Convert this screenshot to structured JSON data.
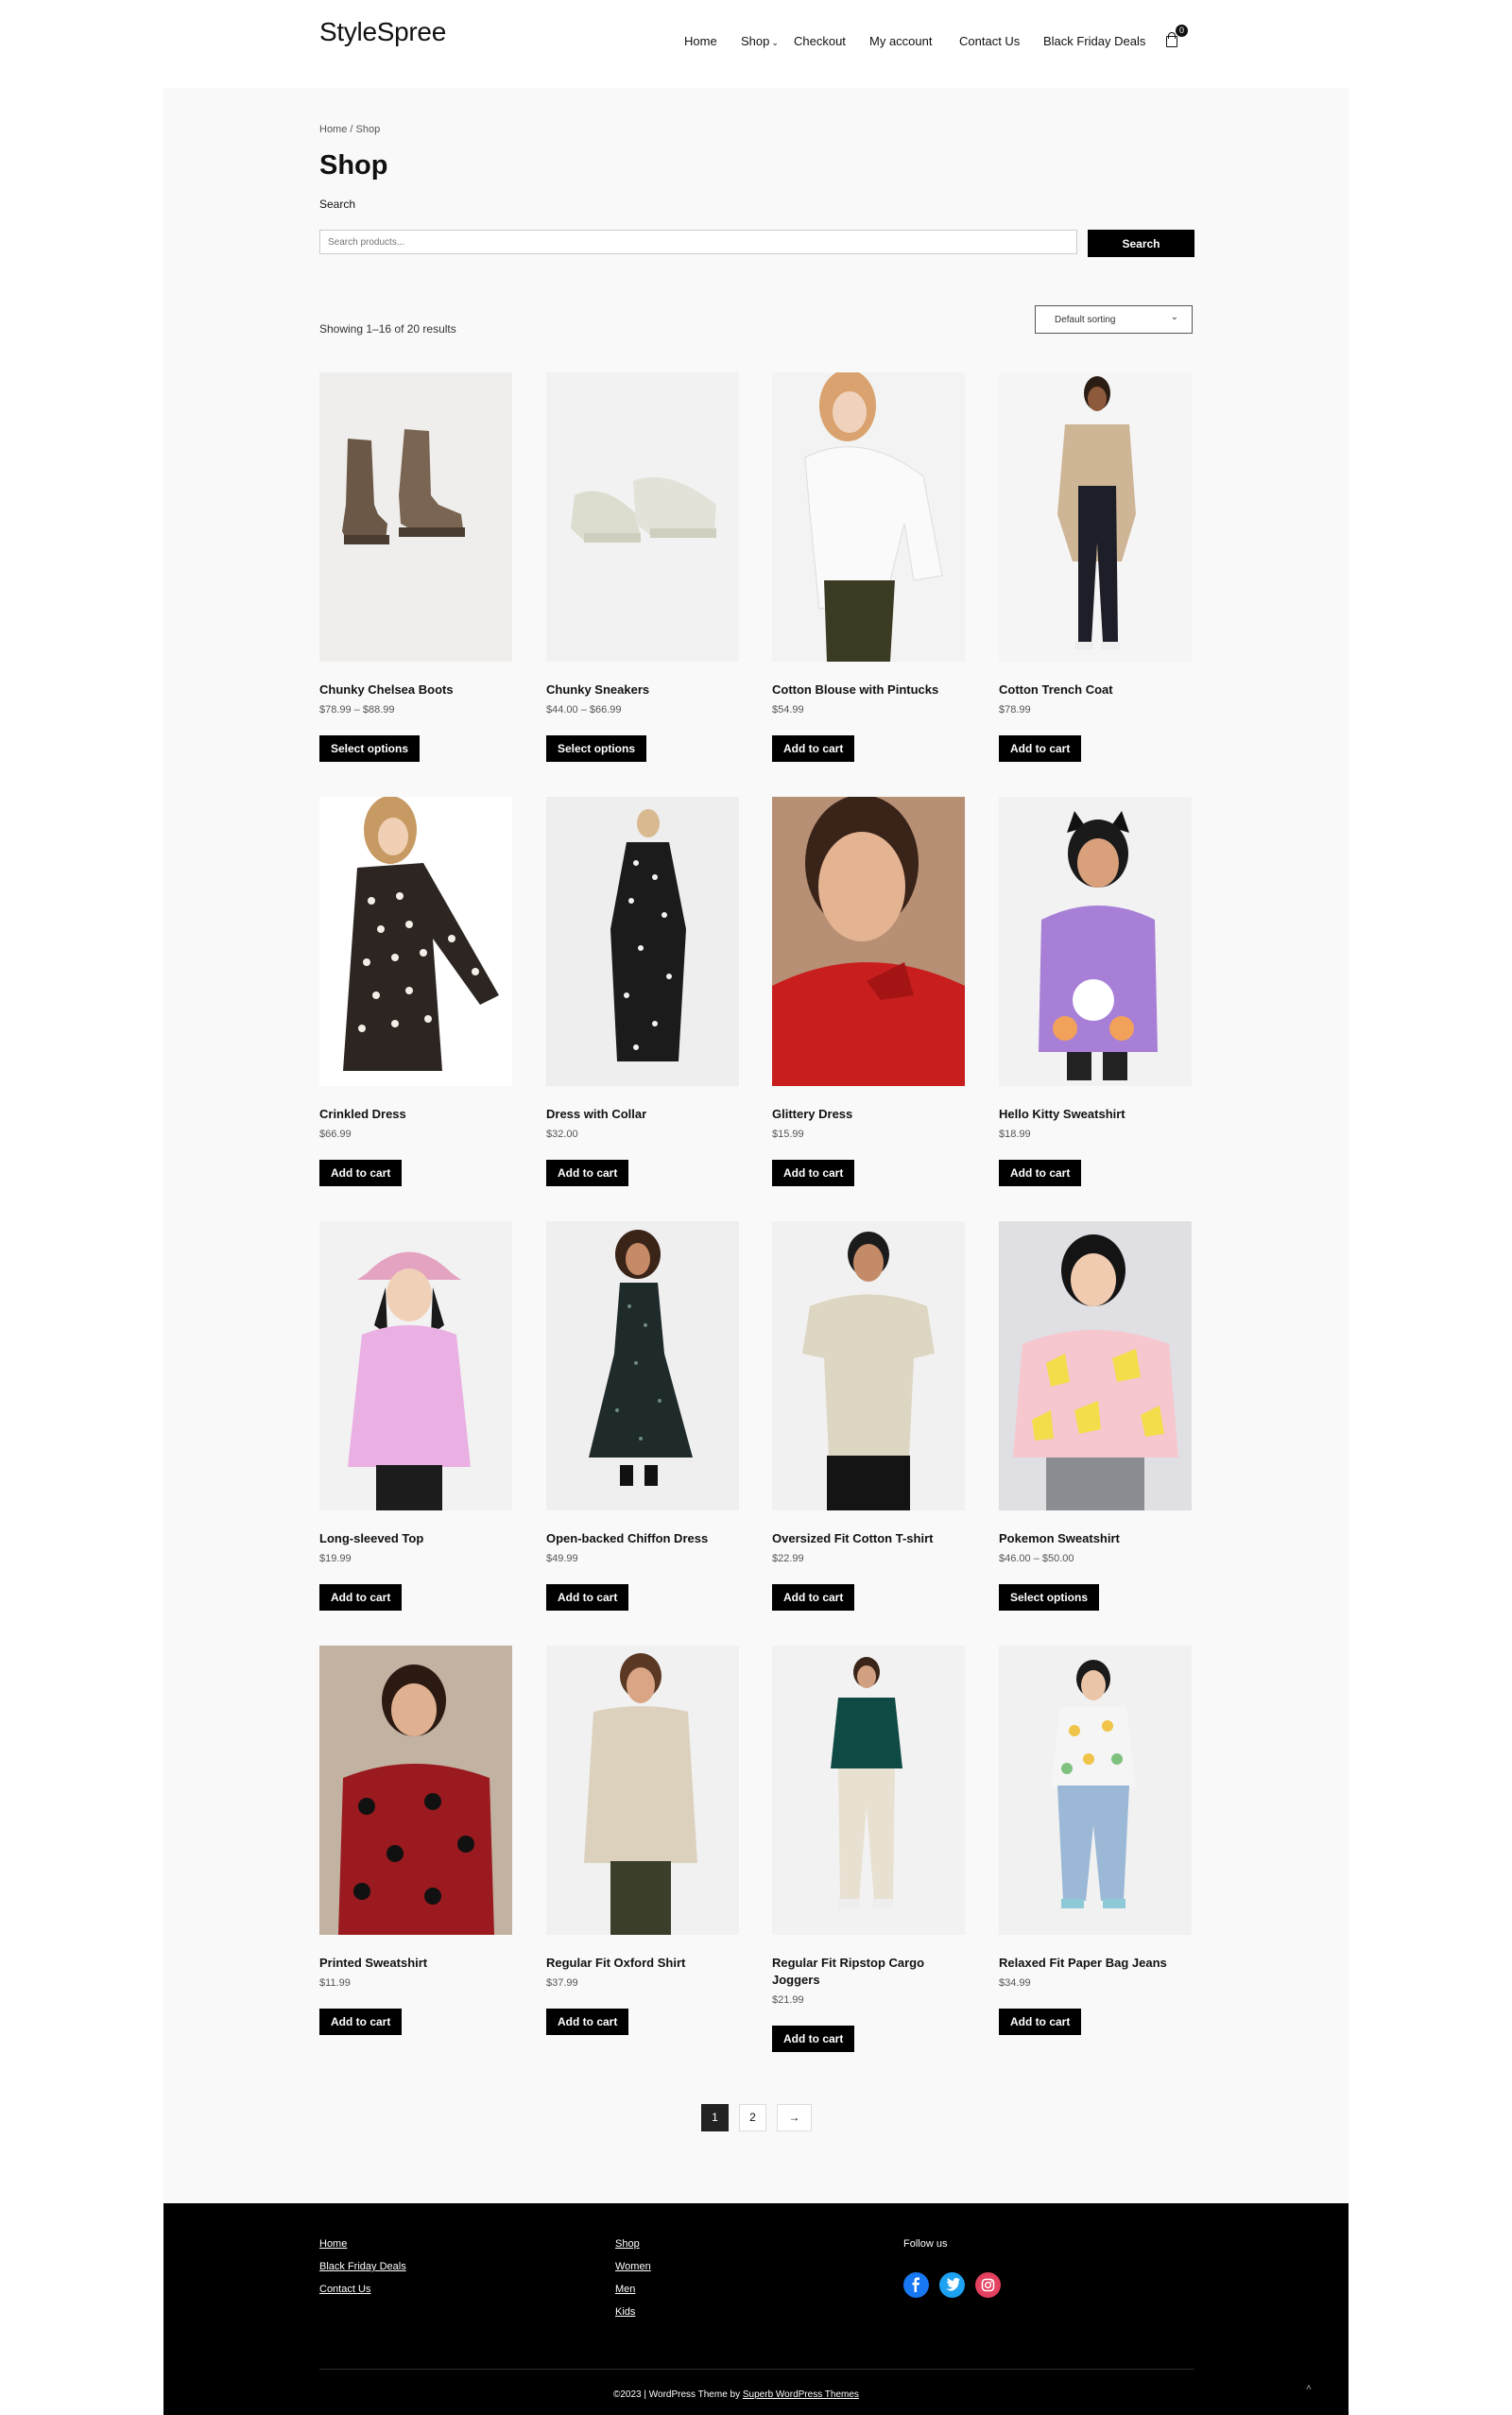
{
  "brand": {
    "logo": "StyleSpree"
  },
  "nav": {
    "items": [
      "Home",
      "Shop",
      "Checkout",
      "My account",
      "Contact Us",
      "Black Friday Deals"
    ],
    "cart_count": "0"
  },
  "breadcrumb": "Home / Shop",
  "page": {
    "title": "Shop",
    "search_label": "Search",
    "search_placeholder": "Search products...",
    "search_button": "Search",
    "result_count": "Showing 1–16 of 20 results",
    "sort_value": "Default sorting"
  },
  "products": [
    {
      "name": "Chunky Chelsea Boots",
      "price": "$78.99 – $88.99",
      "button": "Select options"
    },
    {
      "name": "Chunky Sneakers",
      "price": "$44.00 – $66.99",
      "button": "Select options"
    },
    {
      "name": "Cotton Blouse with Pintucks",
      "price": "$54.99",
      "button": "Add to cart"
    },
    {
      "name": "Cotton Trench Coat",
      "price": "$78.99",
      "button": "Add to cart"
    },
    {
      "name": "Crinkled Dress",
      "price": "$66.99",
      "button": "Add to cart"
    },
    {
      "name": "Dress with Collar",
      "price": "$32.00",
      "button": "Add to cart"
    },
    {
      "name": "Glittery Dress",
      "price": "$15.99",
      "button": "Add to cart"
    },
    {
      "name": "Hello Kitty Sweatshirt",
      "price": "$18.99",
      "button": "Add to cart"
    },
    {
      "name": "Long-sleeved Top",
      "price": "$19.99",
      "button": "Add to cart"
    },
    {
      "name": "Open-backed Chiffon Dress",
      "price": "$49.99",
      "button": "Add to cart"
    },
    {
      "name": "Oversized Fit Cotton T-shirt",
      "price": "$22.99",
      "button": "Add to cart"
    },
    {
      "name": "Pokemon Sweatshirt",
      "price": "$46.00 – $50.00",
      "button": "Select options"
    },
    {
      "name": "Printed Sweatshirt",
      "price": "$11.99",
      "button": "Add to cart"
    },
    {
      "name": "Regular Fit Oxford Shirt",
      "price": "$37.99",
      "button": "Add to cart"
    },
    {
      "name": "Regular Fit Ripstop Cargo Joggers",
      "price": "$21.99",
      "button": "Add to cart"
    },
    {
      "name": "Relaxed Fit Paper Bag Jeans",
      "price": "$34.99",
      "button": "Add to cart"
    }
  ],
  "pagination": {
    "current": "1",
    "next_page": "2",
    "next_arrow": "→"
  },
  "footer": {
    "col1": [
      "Home",
      "Black Friday Deals",
      "Contact Us"
    ],
    "col2": [
      "Shop",
      "Women",
      "Men",
      "Kids"
    ],
    "follow_label": "Follow us",
    "copyright": "©2023 | WordPress Theme by ",
    "theme_link": "Superb WordPress Themes",
    "back_to_top": "˄"
  },
  "icons": {
    "cart": "cart-icon",
    "facebook": "facebook-icon",
    "twitter": "twitter-icon",
    "instagram": "instagram-icon"
  },
  "colors": {
    "facebook": "#1877f2",
    "twitter": "#1da1f2",
    "instagram": "#e4405f",
    "accent": "#000000"
  }
}
